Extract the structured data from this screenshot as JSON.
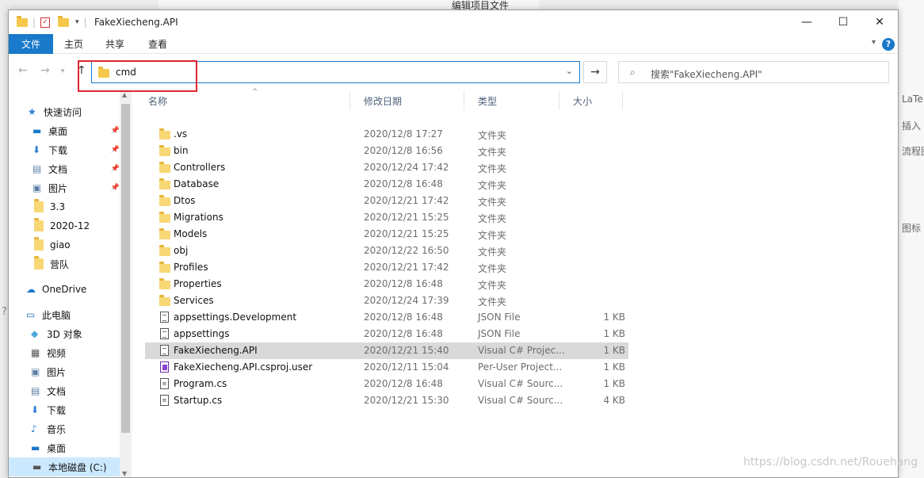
{
  "background": {
    "top_text": "编辑项目文件",
    "right_items": [
      "LaTe",
      "插入",
      "流程图",
      "图标"
    ],
    "watermark": "https://blog.csdn.net/Rouehang"
  },
  "window": {
    "title": "FakeXiecheng.API",
    "controls": {
      "minimize": "—",
      "maximize": "☐",
      "close": "✕"
    }
  },
  "ribbon": {
    "tabs": [
      "文件",
      "主页",
      "共享",
      "查看"
    ],
    "help": "?"
  },
  "address": {
    "value": "cmd",
    "search_placeholder": "搜索\"FakeXiecheng.API\""
  },
  "nav": {
    "items": [
      {
        "label": "快速访问",
        "icon": "star-icon",
        "pinned": false
      },
      {
        "label": "桌面",
        "icon": "desktop-icon",
        "pinned": true
      },
      {
        "label": "下载",
        "icon": "download-icon",
        "pinned": true
      },
      {
        "label": "文档",
        "icon": "document-icon",
        "pinned": true
      },
      {
        "label": "图片",
        "icon": "picture-icon",
        "pinned": true
      },
      {
        "label": "3.3",
        "icon": "folder-icon",
        "pinned": false
      },
      {
        "label": "2020-12",
        "icon": "folder-icon",
        "pinned": false
      },
      {
        "label": "giao",
        "icon": "folder-icon",
        "pinned": false
      },
      {
        "label": "营队",
        "icon": "folder-icon",
        "pinned": false
      },
      {
        "label": "OneDrive",
        "icon": "cloud-icon",
        "pinned": false
      },
      {
        "label": "此电脑",
        "icon": "computer-icon",
        "pinned": false
      },
      {
        "label": "3D 对象",
        "icon": "cube-icon",
        "pinned": false
      },
      {
        "label": "视频",
        "icon": "video-icon",
        "pinned": false
      },
      {
        "label": "图片",
        "icon": "picture-icon",
        "pinned": false
      },
      {
        "label": "文档",
        "icon": "document-icon",
        "pinned": false
      },
      {
        "label": "下载",
        "icon": "download-icon",
        "pinned": false
      },
      {
        "label": "音乐",
        "icon": "music-icon",
        "pinned": false
      },
      {
        "label": "桌面",
        "icon": "desktop-icon",
        "pinned": false
      },
      {
        "label": "本地磁盘 (C:)",
        "icon": "drive-icon",
        "pinned": false
      }
    ]
  },
  "columns": {
    "name": "名称",
    "date": "修改日期",
    "type": "类型",
    "size": "大小"
  },
  "files": [
    {
      "name": ".vs",
      "date": "2020/12/8 17:27",
      "type": "文件夹",
      "size": "",
      "icon": "folder-icon"
    },
    {
      "name": "bin",
      "date": "2020/12/8 16:56",
      "type": "文件夹",
      "size": "",
      "icon": "folder-icon"
    },
    {
      "name": "Controllers",
      "date": "2020/12/24 17:42",
      "type": "文件夹",
      "size": "",
      "icon": "folder-icon"
    },
    {
      "name": "Database",
      "date": "2020/12/8 16:48",
      "type": "文件夹",
      "size": "",
      "icon": "folder-icon"
    },
    {
      "name": "Dtos",
      "date": "2020/12/21 17:42",
      "type": "文件夹",
      "size": "",
      "icon": "folder-icon"
    },
    {
      "name": "Migrations",
      "date": "2020/12/21 15:25",
      "type": "文件夹",
      "size": "",
      "icon": "folder-icon"
    },
    {
      "name": "Models",
      "date": "2020/12/21 15:25",
      "type": "文件夹",
      "size": "",
      "icon": "folder-icon"
    },
    {
      "name": "obj",
      "date": "2020/12/22 16:50",
      "type": "文件夹",
      "size": "",
      "icon": "folder-icon"
    },
    {
      "name": "Profiles",
      "date": "2020/12/21 17:42",
      "type": "文件夹",
      "size": "",
      "icon": "folder-icon"
    },
    {
      "name": "Properties",
      "date": "2020/12/8 16:48",
      "type": "文件夹",
      "size": "",
      "icon": "folder-icon"
    },
    {
      "name": "Services",
      "date": "2020/12/24 17:39",
      "type": "文件夹",
      "size": "",
      "icon": "folder-icon"
    },
    {
      "name": "appsettings.Development",
      "date": "2020/12/8 16:48",
      "type": "JSON File",
      "size": "1 KB",
      "icon": "json-file-icon"
    },
    {
      "name": "appsettings",
      "date": "2020/12/8 16:48",
      "type": "JSON File",
      "size": "1 KB",
      "icon": "json-file-icon"
    },
    {
      "name": "FakeXiecheng.API",
      "date": "2020/12/21 15:40",
      "type": "Visual C# Projec...",
      "size": "1 KB",
      "icon": "file-icon",
      "selected": true
    },
    {
      "name": "FakeXiecheng.API.csproj.user",
      "date": "2020/12/11 15:04",
      "type": "Per-User Project...",
      "size": "1 KB",
      "icon": "vs-project-icon"
    },
    {
      "name": "Program.cs",
      "date": "2020/12/8 16:48",
      "type": "Visual C# Sourc...",
      "size": "1 KB",
      "icon": "csharp-file-icon"
    },
    {
      "name": "Startup.cs",
      "date": "2020/12/21 15:30",
      "type": "Visual C# Sourc...",
      "size": "4 KB",
      "icon": "csharp-file-icon"
    }
  ]
}
